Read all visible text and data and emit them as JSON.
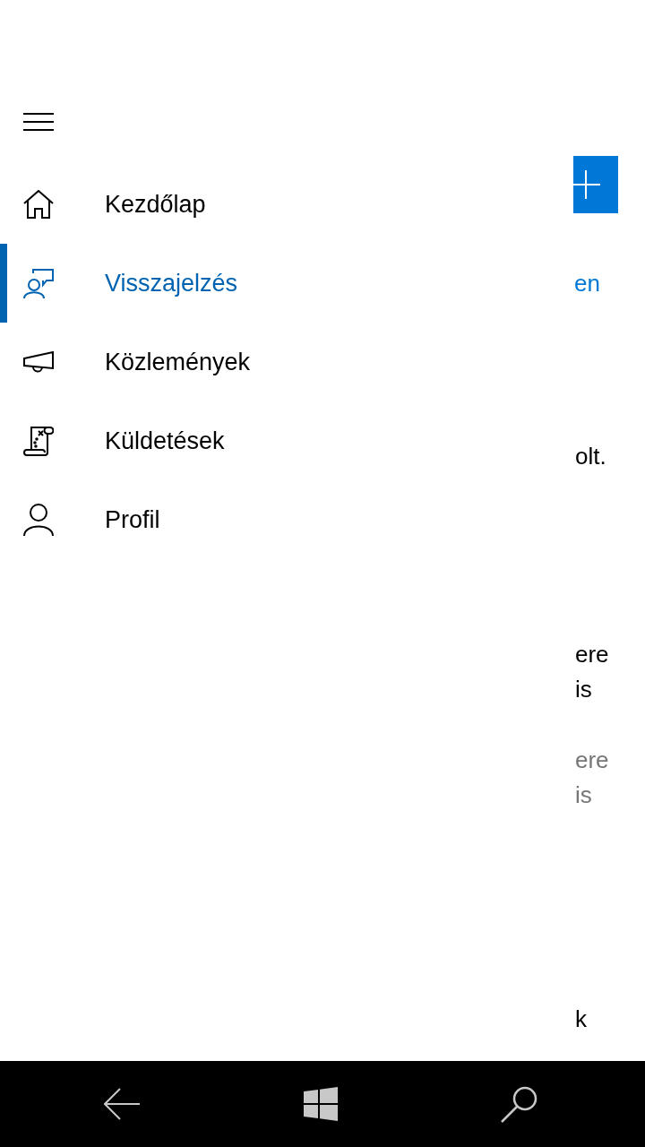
{
  "nav_items": [
    {
      "label": "Kezdőlap",
      "selected": false
    },
    {
      "label": "Visszajelzés",
      "selected": true
    },
    {
      "label": "Közlemények",
      "selected": false
    },
    {
      "label": "Küldetések",
      "selected": false
    },
    {
      "label": "Profil",
      "selected": false
    }
  ],
  "content": {
    "link": "en",
    "paragraphs": [
      {
        "kind": "body",
        "lines": [
          "olt."
        ]
      },
      {
        "kind": "body",
        "lines": [
          "ere",
          "is"
        ]
      },
      {
        "kind": "secondary",
        "lines": [
          "ere",
          "is"
        ]
      }
    ],
    "footer": "k"
  }
}
